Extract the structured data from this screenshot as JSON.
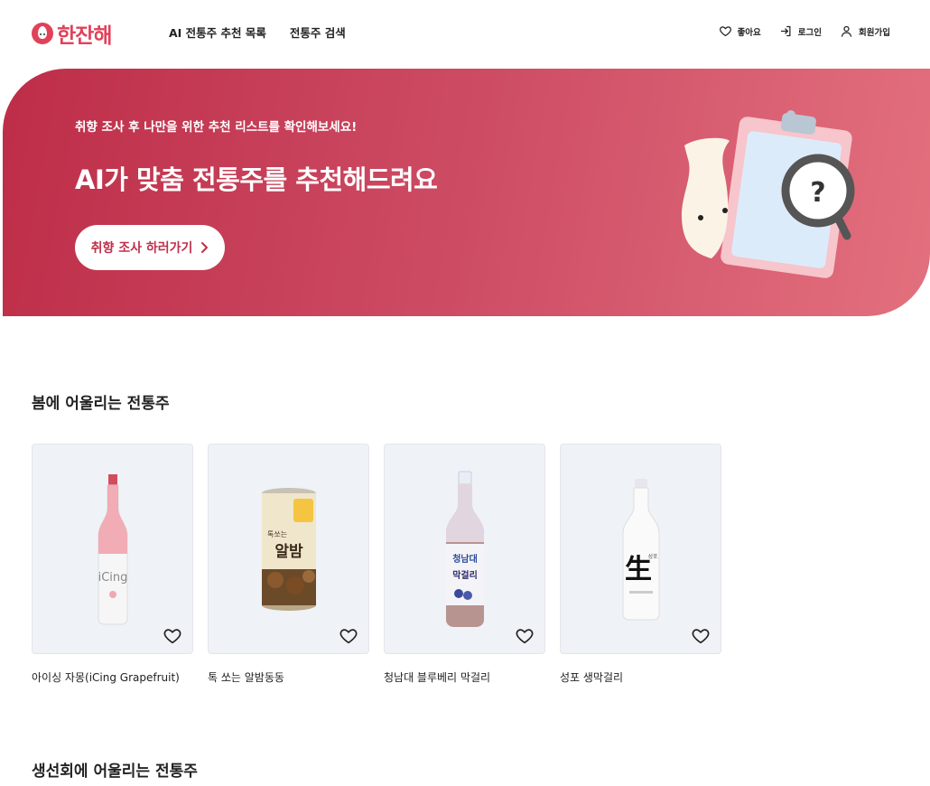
{
  "header": {
    "logo_text": "한잔해",
    "nav": [
      "AI 전통주 추천 목록",
      "전통주 검색"
    ],
    "util": {
      "like": "좋아요",
      "login": "로그인",
      "signup": "회원가입"
    }
  },
  "hero": {
    "subtitle": "취향 조사 후 나만을 위한 추천 리스트를 확인해보세요!",
    "title": "AI가 맞춤 전통주를 추천해드려요",
    "button_label": "취향 조사 하러가기"
  },
  "sections": [
    {
      "title": "봄에 어울리는 전통주",
      "products": [
        {
          "name": "아이싱 자몽(iCing Grapefruit)",
          "icon": "pink-glass-bottle"
        },
        {
          "name": "톡 쏘는 알밤동동",
          "icon": "chestnut-can"
        },
        {
          "name": "청남대 블루베리 막걸리",
          "icon": "blueberry-makgeolli-bottle"
        },
        {
          "name": "성포 생막걸리",
          "icon": "white-makgeolli-bottle"
        }
      ]
    },
    {
      "title": "생선회에 어울리는 전통주"
    }
  ],
  "colors": {
    "brand": "#e2415a",
    "hero_start": "#be2d48",
    "hero_end": "#e3707e",
    "card_bg": "#eff2f6"
  }
}
